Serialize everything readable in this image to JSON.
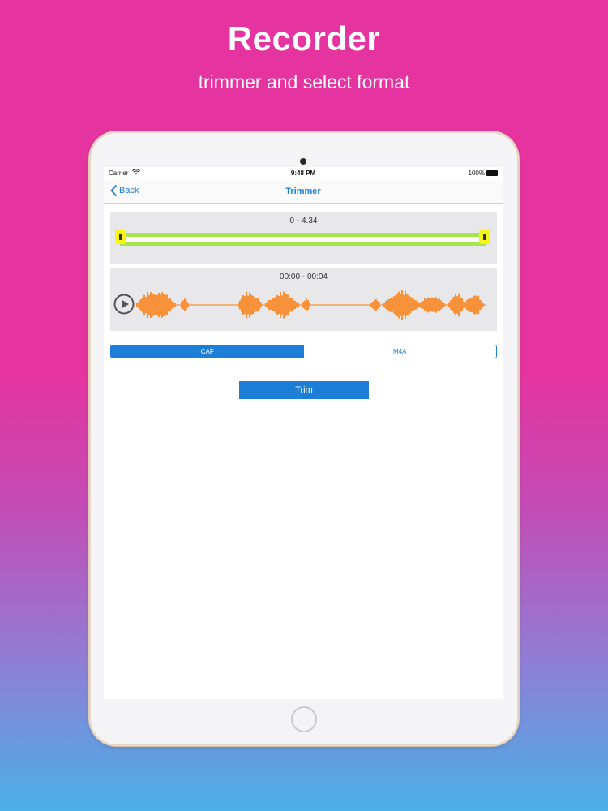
{
  "promo": {
    "title": "Recorder",
    "subtitle": "trimmer and select format"
  },
  "status_bar": {
    "carrier": "Carrier",
    "time": "9:48 PM",
    "battery": "100%"
  },
  "nav": {
    "back_label": "Back",
    "title": "Trimmer"
  },
  "trimmer": {
    "range_label": "0  -  4.34",
    "time_range": "00:00 - 00:04"
  },
  "format_selector": {
    "options": [
      "CAF",
      "M4A"
    ],
    "selected": "CAF"
  },
  "actions": {
    "trim_label": "Trim"
  },
  "colors": {
    "accent": "#1c7ed6",
    "waveform": "#f7923a",
    "range_track": "#a7e34b",
    "range_handle": "#f5f51c"
  }
}
